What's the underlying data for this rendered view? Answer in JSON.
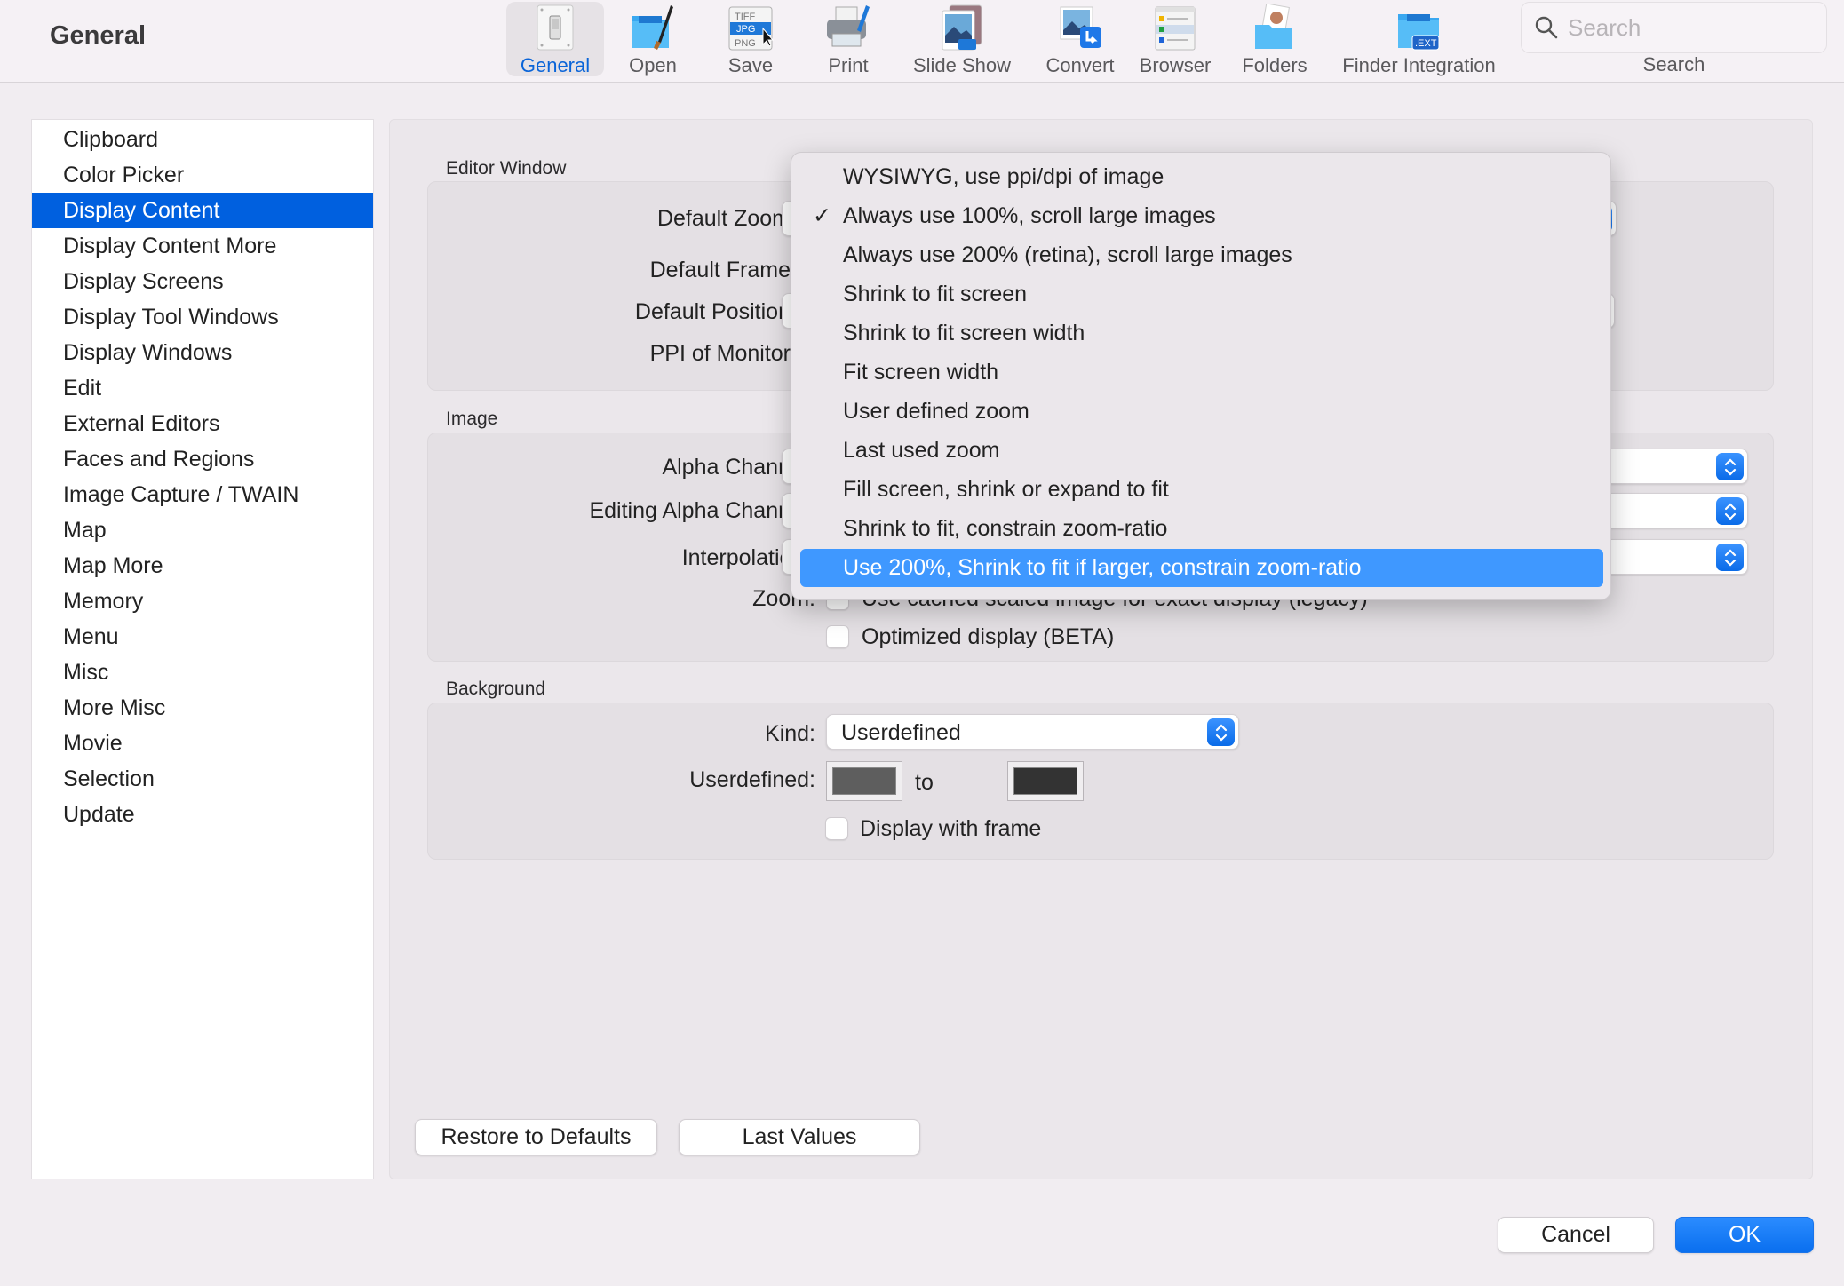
{
  "window": {
    "title": "General"
  },
  "toolbar": {
    "items": [
      {
        "label": "General",
        "icon": "switch-icon",
        "active": true
      },
      {
        "label": "Open",
        "icon": "folder-brush-icon",
        "active": false
      },
      {
        "label": "Save",
        "icon": "file-formats-icon",
        "active": false
      },
      {
        "label": "Print",
        "icon": "printer-icon",
        "active": false
      },
      {
        "label": "Slide Show",
        "icon": "slideshow-icon",
        "active": false
      },
      {
        "label": "Convert",
        "icon": "convert-icon",
        "active": false
      },
      {
        "label": "Browser",
        "icon": "browser-icon",
        "active": false
      },
      {
        "label": "Folders",
        "icon": "folders-icon",
        "active": false
      },
      {
        "label": "Finder Integration",
        "icon": "finder-ext-icon",
        "active": false
      }
    ],
    "save_icon_text": [
      "TIFF",
      "JPG",
      "PNG"
    ],
    "finder_icon_text": ".EXT",
    "search": {
      "placeholder": "Search",
      "value": "",
      "label": "Search"
    }
  },
  "sidebar": {
    "items": [
      {
        "label": "Clipboard",
        "selected": false
      },
      {
        "label": "Color Picker",
        "selected": false
      },
      {
        "label": "Display Content",
        "selected": true
      },
      {
        "label": "Display Content More",
        "selected": false
      },
      {
        "label": "Display Screens",
        "selected": false
      },
      {
        "label": "Display Tool Windows",
        "selected": false
      },
      {
        "label": "Display Windows",
        "selected": false
      },
      {
        "label": "Edit",
        "selected": false
      },
      {
        "label": "External Editors",
        "selected": false
      },
      {
        "label": "Faces and Regions",
        "selected": false
      },
      {
        "label": "Image Capture / TWAIN",
        "selected": false
      },
      {
        "label": "Map",
        "selected": false
      },
      {
        "label": "Map More",
        "selected": false
      },
      {
        "label": "Memory",
        "selected": false
      },
      {
        "label": "Menu",
        "selected": false
      },
      {
        "label": "Misc",
        "selected": false
      },
      {
        "label": "More Misc",
        "selected": false
      },
      {
        "label": "Movie",
        "selected": false
      },
      {
        "label": "Selection",
        "selected": false
      },
      {
        "label": "Update",
        "selected": false
      }
    ]
  },
  "editor_window": {
    "group_label": "Editor Window",
    "default_zoom_label": "Default Zoom",
    "default_frame_label": "Default Frame",
    "default_position_label": "Default Position",
    "ppi_label": "PPI of Monitor"
  },
  "image": {
    "group_label": "Image",
    "alpha_channel_label": "Alpha Chann",
    "editing_alpha_label": "Editing Alpha Chann",
    "interpolation_label": "Interpolatic",
    "zoom_label": "Zoom:",
    "cached_checkbox": {
      "label": "Use cached scaled image for exact display (legacy)",
      "checked": false
    },
    "optimized_checkbox": {
      "label": "Optimized display (BETA)",
      "checked": false
    }
  },
  "background": {
    "group_label": "Background",
    "kind_label": "Kind:",
    "kind_value": "Userdefined",
    "userdefined_label": "Userdefined:",
    "to_label": "to",
    "color_from": "#5e5e5e",
    "color_to": "#333333",
    "frame_checkbox": {
      "label": "Display with frame",
      "checked": false
    }
  },
  "buttons": {
    "restore": "Restore to Defaults",
    "last_values": "Last Values",
    "cancel": "Cancel",
    "ok": "OK"
  },
  "zoom_menu": {
    "items": [
      {
        "label": "WYSIWYG, use ppi/dpi of image",
        "checked": false,
        "highlighted": false
      },
      {
        "label": "Always use 100%, scroll large images",
        "checked": true,
        "highlighted": false
      },
      {
        "label": "Always use 200% (retina), scroll large images",
        "checked": false,
        "highlighted": false
      },
      {
        "label": "Shrink to fit screen",
        "checked": false,
        "highlighted": false
      },
      {
        "label": "Shrink to fit screen width",
        "checked": false,
        "highlighted": false
      },
      {
        "label": "Fit screen width",
        "checked": false,
        "highlighted": false
      },
      {
        "label": "User defined zoom",
        "checked": false,
        "highlighted": false
      },
      {
        "label": "Last used zoom",
        "checked": false,
        "highlighted": false
      },
      {
        "label": "Fill screen, shrink or expand to fit",
        "checked": false,
        "highlighted": false
      },
      {
        "label": "Shrink to fit, constrain zoom-ratio",
        "checked": false,
        "highlighted": false
      },
      {
        "label": "Use 200%, Shrink to fit if larger, constrain zoom-ratio",
        "checked": false,
        "highlighted": true
      }
    ],
    "check_glyph": "✓"
  },
  "colors": {
    "accent": "#0060df",
    "menu_highlight": "#3f98ff"
  }
}
